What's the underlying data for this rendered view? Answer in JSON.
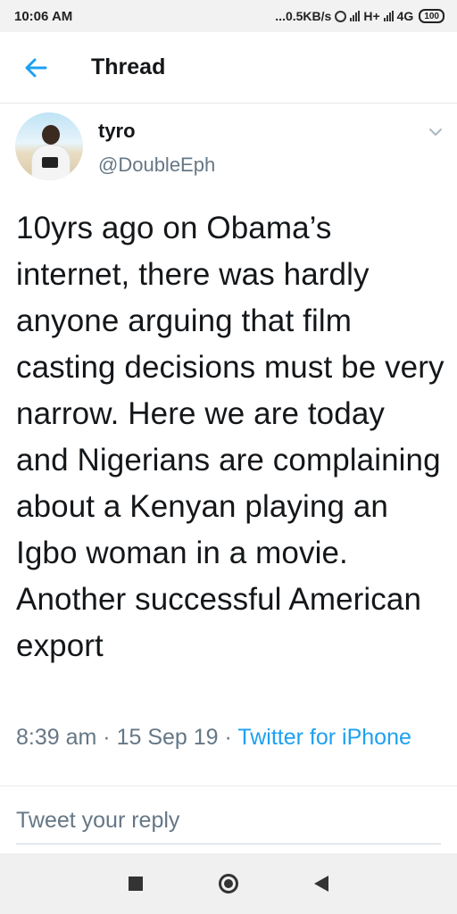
{
  "status_bar": {
    "time": "10:06 AM",
    "net_speed": "...0.5KB/s",
    "network_h": "H+",
    "network_4g": "4G",
    "battery": "100"
  },
  "header": {
    "title": "Thread",
    "back_icon": "arrow-left-icon"
  },
  "tweet": {
    "name": "tyro",
    "handle": "@DoubleEph",
    "text": "10yrs ago on Obama’s internet, there was hardly anyone arguing that film casting decisions must be very narrow. Here we are today and Nigerians are complaining about a Kenyan playing an Igbo woman in a movie. Another successful American export",
    "time": "8:39 am",
    "date": "15 Sep 19",
    "separator": "·",
    "source": "Twitter for iPhone"
  },
  "reply": {
    "placeholder": "Tweet your reply"
  },
  "colors": {
    "accent": "#1da1f2",
    "secondary_text": "#657786",
    "primary_text": "#14171a"
  }
}
